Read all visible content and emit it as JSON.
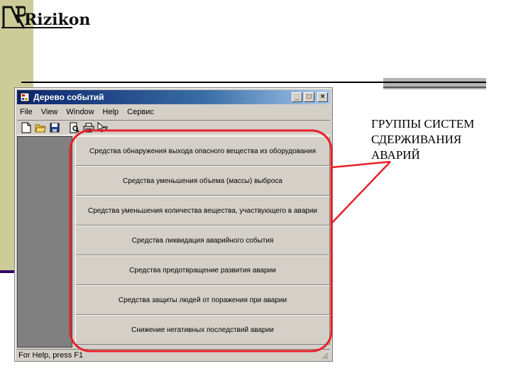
{
  "slide": {
    "logo_text": "Rizikon",
    "callout_lines": [
      "ГРУППЫ СИСТЕМ",
      "СДЕРЖИВАНИЯ",
      "АВАРИЙ"
    ],
    "highlight_color": "#e8202a",
    "band_color": "#cccc99"
  },
  "window": {
    "title": "Дерево событий",
    "title_icon": "app-tree-icon",
    "controls": {
      "minimize": "_",
      "maximize": "□",
      "close": "×"
    },
    "menu": [
      "File",
      "View",
      "Window",
      "Help",
      "Сервис"
    ],
    "toolbar_icons": [
      "new-document-icon",
      "open-folder-icon",
      "save-icon",
      "print-preview-icon",
      "print-icon",
      "context-help-icon"
    ],
    "items": [
      "Средства обнаружения выхода опасного вещества из оборудования",
      "Средства уменьшения объема (массы) выброса",
      "Средства уменьшения количества вещества, участвующего в аварии",
      "Средства ликвидация аварийного события",
      "Средства предотвращение развития аварии",
      "Средства защиты людей от поражения при аварии",
      "Снижение негативных последствий аварии"
    ],
    "status": "For Help, press F1"
  }
}
